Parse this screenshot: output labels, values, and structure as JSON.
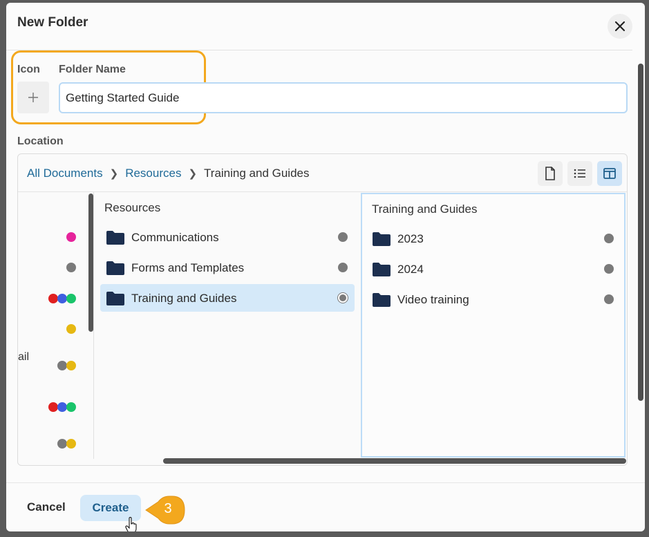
{
  "dialog": {
    "title": "New Folder",
    "icon_label": "Icon",
    "folder_name_label": "Folder Name",
    "folder_name_value": "Getting Started Guide",
    "location_label": "Location"
  },
  "breadcrumb": {
    "items": [
      "All Documents",
      "Resources"
    ],
    "current": "Training and Guides"
  },
  "left_column": {
    "partial_text": "ail"
  },
  "resources_column": {
    "title": "Resources",
    "folders": [
      {
        "label": "Communications"
      },
      {
        "label": "Forms and Templates"
      },
      {
        "label": "Training and Guides",
        "selected": true
      }
    ]
  },
  "training_column": {
    "title": "Training and Guides",
    "folders": [
      {
        "label": "2023"
      },
      {
        "label": "2024"
      },
      {
        "label": "Video training"
      }
    ]
  },
  "footer": {
    "cancel_label": "Cancel",
    "create_label": "Create",
    "step_number": "3"
  },
  "colors": {
    "accent": "#1f6a98",
    "highlight": "#f3a81e",
    "selected_row": "#d5e9f9",
    "folder": "#1c2f4f",
    "dot_pink": "#e6239b",
    "dot_gray": "#7a7a7a",
    "dot_red": "#e02020",
    "dot_blue": "#3f5fe0",
    "dot_green": "#19c46a",
    "dot_yellow": "#e6b812"
  }
}
